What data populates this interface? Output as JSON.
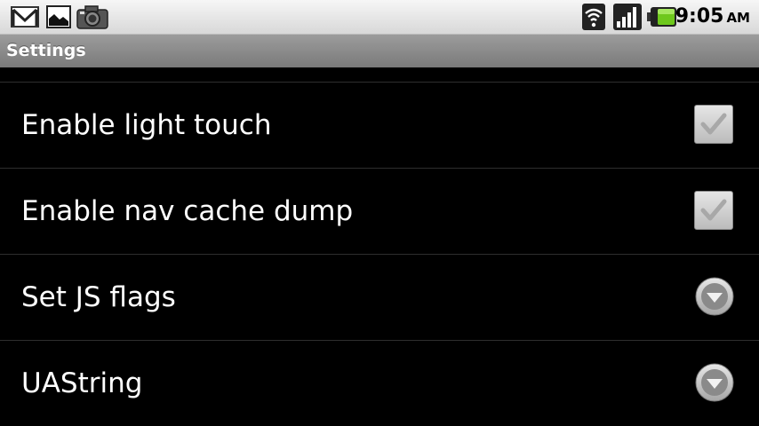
{
  "status_bar": {
    "icons": [
      "gmail-icon",
      "gallery-icon",
      "camera-icon",
      "wifi-icon",
      "signal-icon",
      "battery-icon"
    ],
    "time": "9:05",
    "ampm": "AM"
  },
  "title_bar": {
    "title": "Settings"
  },
  "settings": {
    "items": [
      {
        "label": "Enable light touch",
        "control": "checkbox",
        "checked": true
      },
      {
        "label": "Enable nav cache dump",
        "control": "checkbox",
        "checked": true
      },
      {
        "label": "Set JS flags",
        "control": "dropdown"
      },
      {
        "label": "UAString",
        "control": "dropdown"
      }
    ]
  },
  "colors": {
    "background": "#000000",
    "title_bar": "#8c8c8c",
    "text": "#ffffff",
    "divider": "#2e2e2e"
  }
}
